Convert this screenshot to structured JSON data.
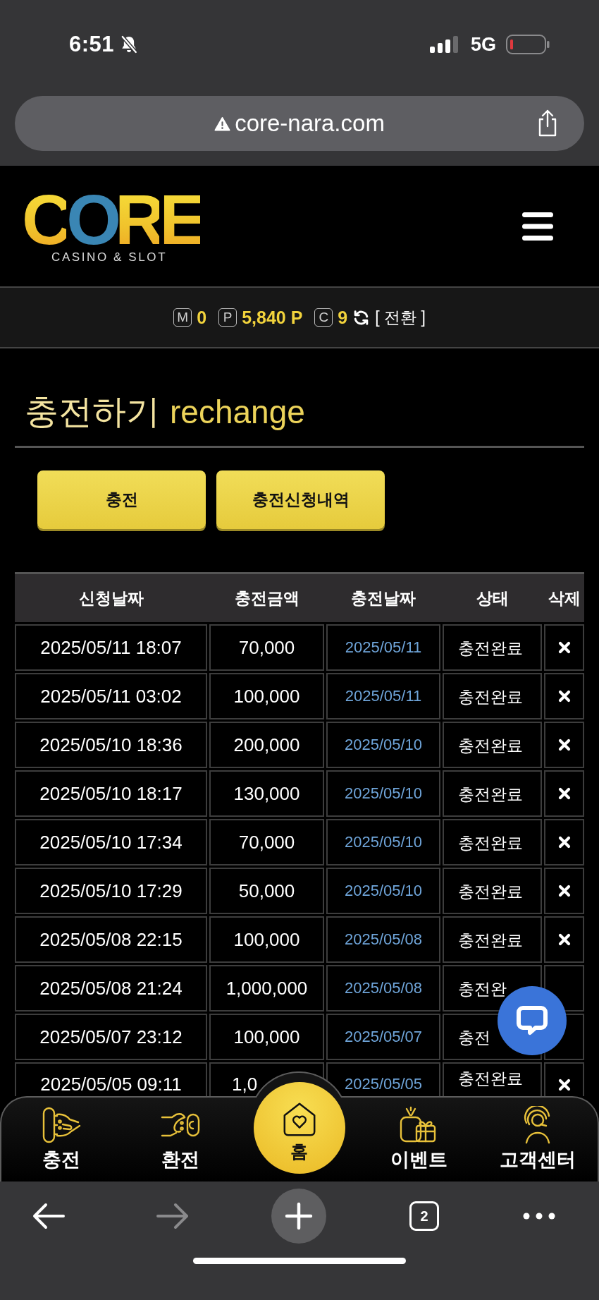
{
  "status_bar": {
    "time": "6:51",
    "network": "5G"
  },
  "browser": {
    "url": "core-nara.com",
    "tab_count": "2",
    "back_disabled": false,
    "forward_disabled": true
  },
  "header": {
    "logo": "CORE",
    "logo_tagline": "CASINO & SLOT"
  },
  "balances": [
    {
      "label": "M",
      "value": "0"
    },
    {
      "label": "P",
      "value": "5,840 P"
    },
    {
      "label": "C",
      "value": "9"
    }
  ],
  "convert_link": "[ 전환 ]",
  "page": {
    "title": "충전하기",
    "subtitle": "rechange"
  },
  "buttons": [
    "충전",
    "충전신청내역"
  ],
  "table": {
    "columns": [
      "신청날짜",
      "충전금액",
      "충전날짜",
      "상태",
      "삭제"
    ],
    "rows": [
      {
        "requested": "2025/05/11 18:07",
        "amount": "70,000",
        "charged": "2025/05/11",
        "status": "충전완료",
        "delete_icon": true
      },
      {
        "requested": "2025/05/11 03:02",
        "amount": "100,000",
        "charged": "2025/05/11",
        "status": "충전완료",
        "delete_icon": true
      },
      {
        "requested": "2025/05/10 18:36",
        "amount": "200,000",
        "charged": "2025/05/10",
        "status": "충전완료",
        "delete_icon": true
      },
      {
        "requested": "2025/05/10 18:17",
        "amount": "130,000",
        "charged": "2025/05/10",
        "status": "충전완료",
        "delete_icon": true
      },
      {
        "requested": "2025/05/10 17:34",
        "amount": "70,000",
        "charged": "2025/05/10",
        "status": "충전완료",
        "delete_icon": true
      },
      {
        "requested": "2025/05/10 17:29",
        "amount": "50,000",
        "charged": "2025/05/10",
        "status": "충전완료",
        "delete_icon": true
      },
      {
        "requested": "2025/05/08 22:15",
        "amount": "100,000",
        "charged": "2025/05/08",
        "status": "충전완료",
        "delete_icon": true
      },
      {
        "requested": "2025/05/08 21:24",
        "amount": "1,000,000",
        "charged": "2025/05/08",
        "status": "충전완",
        "delete_icon": false
      },
      {
        "requested": "2025/05/07 23:12",
        "amount": "100,000",
        "charged": "2025/05/07",
        "status": "충전",
        "delete_icon": false
      },
      {
        "requested": "2025/05/05 09:11",
        "amount": "1,0",
        "charged": "2025/05/05",
        "status": "충전완료",
        "delete_icon": true
      }
    ]
  },
  "bottom_nav": [
    {
      "label": "충전",
      "kind": "item"
    },
    {
      "label": "환전",
      "kind": "item"
    },
    {
      "label": "홈",
      "kind": "home"
    },
    {
      "label": "이벤트",
      "kind": "item"
    },
    {
      "label": "고객센터",
      "kind": "item"
    }
  ]
}
